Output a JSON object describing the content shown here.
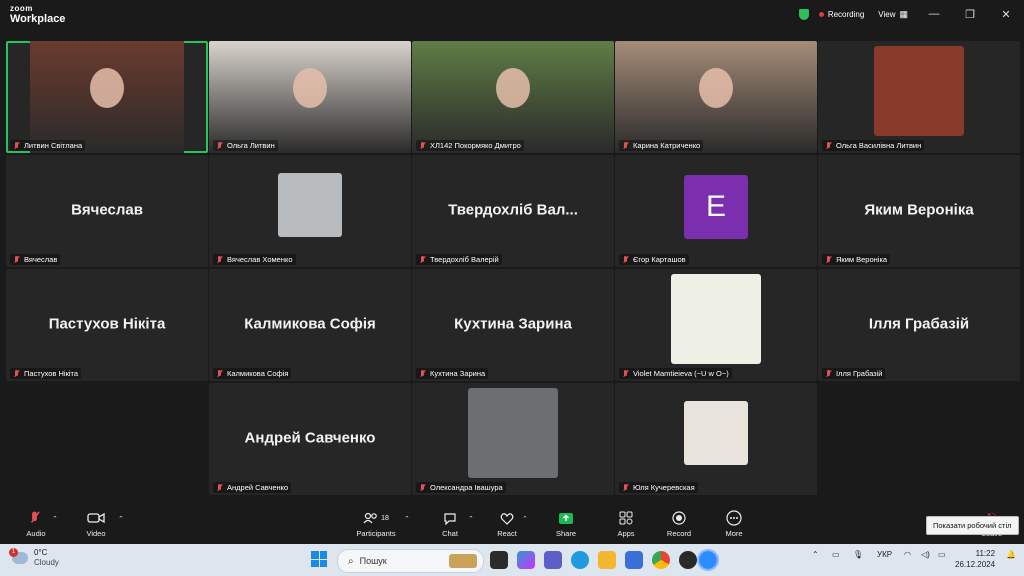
{
  "window": {
    "brand_top": "zoom",
    "brand_bottom": "Workplace",
    "recording_label": "Recording",
    "view_label": "View",
    "minimize": "—",
    "maximize": "❐",
    "close": "✕"
  },
  "tiles": [
    {
      "name": "Литвин Світлана",
      "type": "video",
      "active": true,
      "bg": "#6b3b2e"
    },
    {
      "name": "Ольга Литвин",
      "type": "video",
      "bg": "#d9d3cc"
    },
    {
      "name": "ХЛ142 Покормяко Дмитро",
      "type": "video",
      "bg": "#5f7d46"
    },
    {
      "name": "Карина Катриченко",
      "type": "video",
      "bg": "#a58c78"
    },
    {
      "name": "Ольга Василівна Литвин",
      "type": "avatar",
      "bg": "#8a3a2a"
    },
    {
      "name": "Вячеслав",
      "type": "text",
      "big": "Вячеслав"
    },
    {
      "name": "Вячеслав Хоменко",
      "type": "avatar",
      "bg": "#b9bcbf"
    },
    {
      "name": "Твердохліб Валерій",
      "type": "text",
      "big": "Твердохліб Вал..."
    },
    {
      "name": "Єгор Карташов",
      "type": "letter",
      "big": "E",
      "bg": "#7b2fae"
    },
    {
      "name": "Яким Вероніка",
      "type": "text",
      "big": "Яким Вероніка"
    },
    {
      "name": "Пастухов Нікіта",
      "type": "text",
      "big": "Пастухов Нікіта"
    },
    {
      "name": "Калмикова Софія",
      "type": "text",
      "big": "Калмикова Софія"
    },
    {
      "name": "Кухтина Зарина",
      "type": "text",
      "big": "Кухтина Зарина"
    },
    {
      "name": "Violet Mamtieieva (~U w O~)",
      "type": "avatar",
      "bg": "#eef0e6"
    },
    {
      "name": "Ілля Грабазій",
      "type": "text",
      "big": "Ілля Грабазій"
    },
    {
      "name": "Андрей Савченко",
      "type": "text",
      "big": "Андрей Савченко"
    },
    {
      "name": "Олександра Івашура",
      "type": "avatar",
      "bg": "#6c6f72"
    },
    {
      "name": "Юля Кучеревская",
      "type": "avatar",
      "bg": "#e8e4dc"
    }
  ],
  "toolbar": {
    "audio": "Audio",
    "video": "Video",
    "participants": "Participants",
    "participants_count": "18",
    "chat": "Chat",
    "react": "React",
    "share": "Share",
    "apps": "Apps",
    "record": "Record",
    "more": "More",
    "leave": "Leave"
  },
  "tooltip": "Показати робочий стіл",
  "taskbar": {
    "weather_temp": "0°C",
    "weather_desc": "Cloudy",
    "weather_badge": "1",
    "search_placeholder": "Пошук",
    "lang": "УКР",
    "time": "11:22",
    "date": "26.12.2024"
  },
  "colors": {
    "accent_green": "#22c55e",
    "record_red": "#e0393e",
    "share_green": "#1db954"
  }
}
